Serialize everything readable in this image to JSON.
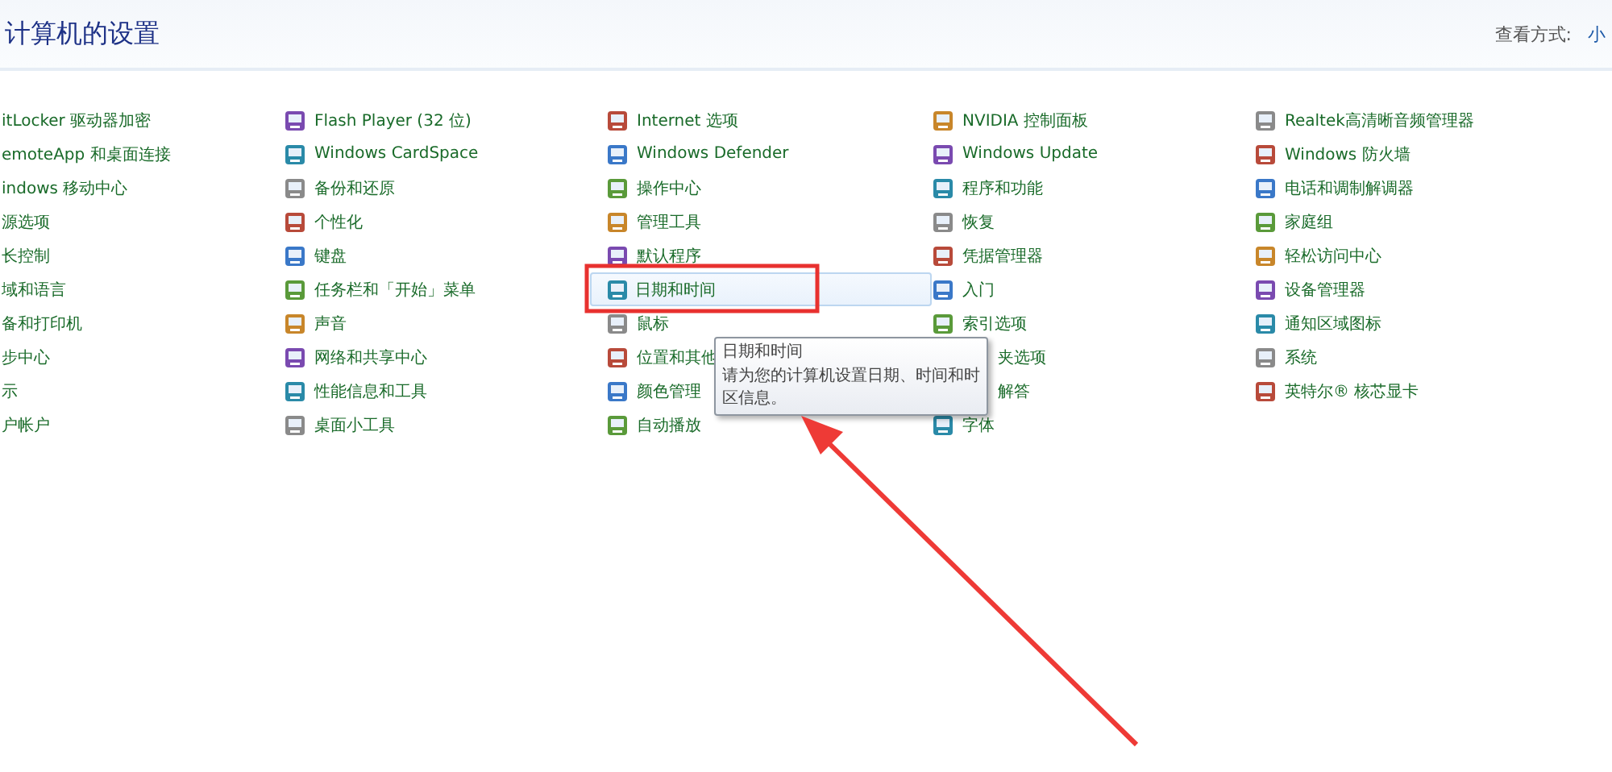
{
  "header": {
    "title": "计算机的设置",
    "view_label": "查看方式:",
    "view_value": "小"
  },
  "columns": [
    {
      "items": [
        {
          "label": "itLocker 驱动器加密",
          "kind": "bare"
        },
        {
          "label": "emoteApp 和桌面连接",
          "kind": "bare"
        },
        {
          "label": "indows 移动中心",
          "kind": "bare"
        },
        {
          "label": "源选项",
          "kind": "bare"
        },
        {
          "label": "长控制",
          "kind": "bare"
        },
        {
          "label": "域和语言",
          "kind": "bare"
        },
        {
          "label": "备和打印机",
          "kind": "bare"
        },
        {
          "label": "步中心",
          "kind": "bare"
        },
        {
          "label": "示",
          "kind": "bare"
        },
        {
          "label": "户帐户",
          "kind": "bare"
        }
      ]
    },
    {
      "items": [
        {
          "label": "Flash Player (32 位)",
          "kind": "icon"
        },
        {
          "label": "Windows CardSpace",
          "kind": "icon"
        },
        {
          "label": "备份和还原",
          "kind": "icon"
        },
        {
          "label": "个性化",
          "kind": "icon"
        },
        {
          "label": "键盘",
          "kind": "icon"
        },
        {
          "label": "任务栏和「开始」菜单",
          "kind": "icon"
        },
        {
          "label": "声音",
          "kind": "icon"
        },
        {
          "label": "网络和共享中心",
          "kind": "icon"
        },
        {
          "label": "性能信息和工具",
          "kind": "icon"
        },
        {
          "label": "桌面小工具",
          "kind": "icon"
        }
      ]
    },
    {
      "items": [
        {
          "label": "Internet 选项",
          "kind": "icon",
          "selected": false
        },
        {
          "label": "Windows Defender",
          "kind": "icon",
          "selected": false
        },
        {
          "label": "操作中心",
          "kind": "icon",
          "selected": false
        },
        {
          "label": "管理工具",
          "kind": "icon",
          "selected": false
        },
        {
          "label": "默认程序",
          "kind": "icon",
          "selected": false
        },
        {
          "label": "日期和时间",
          "kind": "icon",
          "selected": true
        },
        {
          "label": "鼠标",
          "kind": "icon",
          "selected": false
        },
        {
          "label": "位置和其他",
          "kind": "icon",
          "selected": false
        },
        {
          "label": "颜色管理",
          "kind": "icon",
          "selected": false
        },
        {
          "label": "自动播放",
          "kind": "icon",
          "selected": false
        }
      ]
    },
    {
      "items": [
        {
          "label": "NVIDIA 控制面板",
          "kind": "icon"
        },
        {
          "label": "Windows Update",
          "kind": "icon"
        },
        {
          "label": "程序和功能",
          "kind": "icon"
        },
        {
          "label": "恢复",
          "kind": "icon"
        },
        {
          "label": "凭据管理器",
          "kind": "icon"
        },
        {
          "label": "入门",
          "kind": "icon"
        },
        {
          "label": "索引选项",
          "kind": "icon"
        },
        {
          "label": "夹选项",
          "kind": "clipped"
        },
        {
          "label": "解答",
          "kind": "clipped"
        },
        {
          "label": "字体",
          "kind": "icon"
        }
      ]
    },
    {
      "items": [
        {
          "label": "Realtek高清晰音频管理器",
          "kind": "icon"
        },
        {
          "label": "Windows 防火墙",
          "kind": "icon"
        },
        {
          "label": "电话和调制解调器",
          "kind": "icon"
        },
        {
          "label": "家庭组",
          "kind": "icon"
        },
        {
          "label": "轻松访问中心",
          "kind": "icon"
        },
        {
          "label": "设备管理器",
          "kind": "icon"
        },
        {
          "label": "通知区域图标",
          "kind": "icon"
        },
        {
          "label": "系统",
          "kind": "icon"
        },
        {
          "label": "英特尔® 核芯显卡",
          "kind": "icon"
        }
      ]
    }
  ],
  "tooltip": {
    "title": "日期和时间",
    "text": "请为您的计算机设置日期、时间和时区信息。"
  }
}
